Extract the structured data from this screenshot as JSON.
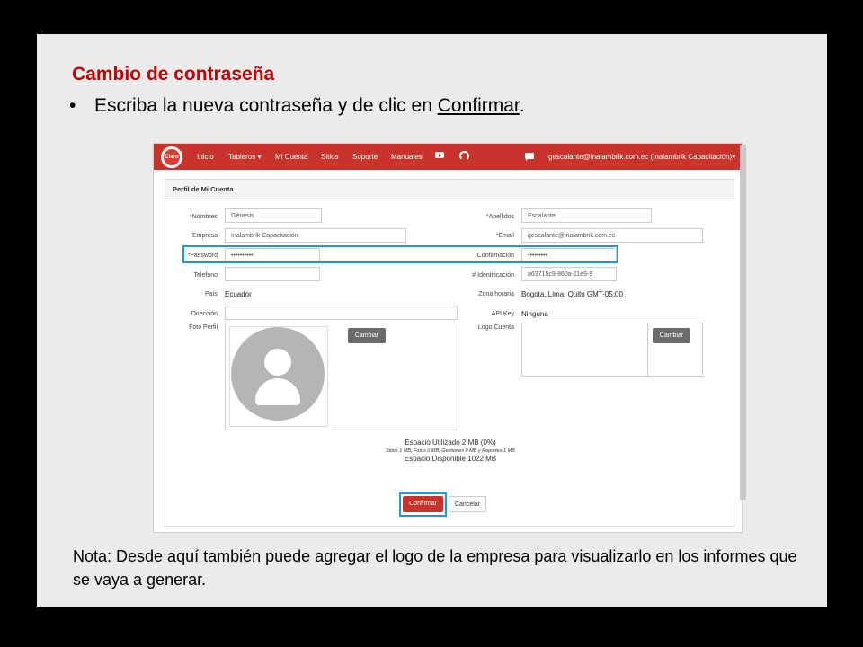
{
  "slide": {
    "title": "Cambio de contraseña",
    "bullet_text": "Escriba la nueva contraseña y de clic en ",
    "bullet_link": "Confirmar",
    "bullet_end": ".",
    "note": "Nota: Desde aquí también puede agregar el logo de la empresa para visualizarlo en los informes que se vaya a generar."
  },
  "navbar": {
    "logo_text": "Claro",
    "items": [
      "Inicio",
      "Tableros",
      "Mi Cuenta",
      "Sitios",
      "Soporte",
      "Manuales"
    ],
    "dropdown_caret": "▾",
    "user": "gescalante@inalambrik.com.ec (Inalambrik Capacitación)"
  },
  "panel": {
    "title": "Perfil de Mi Cuenta",
    "fields": {
      "nombres_label": "Nombres",
      "nombres_value": "Génesis",
      "apellidos_label": "Apellidos",
      "apellidos_value": "Escalante",
      "empresa_label": "Empresa",
      "empresa_value": "Inalambrik Capacitación",
      "email_label": "Email",
      "email_value": "gescalante@inalambrik.com.ec",
      "password_label": "Password",
      "password_value": "••••••••••",
      "confirmacion_label": "Confirmación",
      "confirmacion_value": "•••••••••",
      "telefono_label": "Telefono",
      "telefono_value": "",
      "identificacion_label": "# Identificación",
      "identificacion_value": "a63715c9-860a-11e9-9",
      "pais_label": "País",
      "pais_value": "Ecuador",
      "zona_label": "Zona horaria",
      "zona_value": "Bogota, Lima, Quito GMT-05:00",
      "direccion_label": "Dirección",
      "direccion_value": "",
      "apikey_label": "API Key",
      "apikey_value": "Ninguna",
      "foto_label": "Foto Perfil",
      "logo_label": "Logo Cuenta",
      "required_mark": "*"
    },
    "cambiar_label": "Cambiar",
    "usage": {
      "line1": "Espacio Utilizado 2 MB (0%)",
      "line2": "Sitios 1 MB, Fotos 0 MB, Gestiones 0 MB y Reportes 1 MB",
      "line3": "Espacio Disponible 1022 MB"
    },
    "confirm_label": "Confirmar",
    "cancel_label": "Cancelar"
  },
  "colors": {
    "title_red": "#c00000",
    "navbar_red": "#c8332b",
    "highlight_blue": "#1a9ad6"
  }
}
